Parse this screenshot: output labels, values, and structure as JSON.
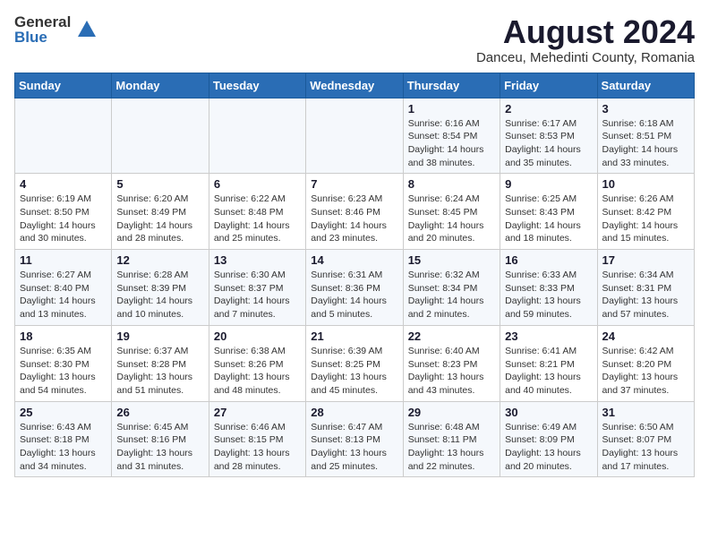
{
  "header": {
    "logo_line1": "General",
    "logo_line2": "Blue",
    "month_title": "August 2024",
    "location": "Danceu, Mehedinti County, Romania"
  },
  "weekdays": [
    "Sunday",
    "Monday",
    "Tuesday",
    "Wednesday",
    "Thursday",
    "Friday",
    "Saturday"
  ],
  "weeks": [
    [
      {
        "day": "",
        "info": ""
      },
      {
        "day": "",
        "info": ""
      },
      {
        "day": "",
        "info": ""
      },
      {
        "day": "",
        "info": ""
      },
      {
        "day": "1",
        "info": "Sunrise: 6:16 AM\nSunset: 8:54 PM\nDaylight: 14 hours\nand 38 minutes."
      },
      {
        "day": "2",
        "info": "Sunrise: 6:17 AM\nSunset: 8:53 PM\nDaylight: 14 hours\nand 35 minutes."
      },
      {
        "day": "3",
        "info": "Sunrise: 6:18 AM\nSunset: 8:51 PM\nDaylight: 14 hours\nand 33 minutes."
      }
    ],
    [
      {
        "day": "4",
        "info": "Sunrise: 6:19 AM\nSunset: 8:50 PM\nDaylight: 14 hours\nand 30 minutes."
      },
      {
        "day": "5",
        "info": "Sunrise: 6:20 AM\nSunset: 8:49 PM\nDaylight: 14 hours\nand 28 minutes."
      },
      {
        "day": "6",
        "info": "Sunrise: 6:22 AM\nSunset: 8:48 PM\nDaylight: 14 hours\nand 25 minutes."
      },
      {
        "day": "7",
        "info": "Sunrise: 6:23 AM\nSunset: 8:46 PM\nDaylight: 14 hours\nand 23 minutes."
      },
      {
        "day": "8",
        "info": "Sunrise: 6:24 AM\nSunset: 8:45 PM\nDaylight: 14 hours\nand 20 minutes."
      },
      {
        "day": "9",
        "info": "Sunrise: 6:25 AM\nSunset: 8:43 PM\nDaylight: 14 hours\nand 18 minutes."
      },
      {
        "day": "10",
        "info": "Sunrise: 6:26 AM\nSunset: 8:42 PM\nDaylight: 14 hours\nand 15 minutes."
      }
    ],
    [
      {
        "day": "11",
        "info": "Sunrise: 6:27 AM\nSunset: 8:40 PM\nDaylight: 14 hours\nand 13 minutes."
      },
      {
        "day": "12",
        "info": "Sunrise: 6:28 AM\nSunset: 8:39 PM\nDaylight: 14 hours\nand 10 minutes."
      },
      {
        "day": "13",
        "info": "Sunrise: 6:30 AM\nSunset: 8:37 PM\nDaylight: 14 hours\nand 7 minutes."
      },
      {
        "day": "14",
        "info": "Sunrise: 6:31 AM\nSunset: 8:36 PM\nDaylight: 14 hours\nand 5 minutes."
      },
      {
        "day": "15",
        "info": "Sunrise: 6:32 AM\nSunset: 8:34 PM\nDaylight: 14 hours\nand 2 minutes."
      },
      {
        "day": "16",
        "info": "Sunrise: 6:33 AM\nSunset: 8:33 PM\nDaylight: 13 hours\nand 59 minutes."
      },
      {
        "day": "17",
        "info": "Sunrise: 6:34 AM\nSunset: 8:31 PM\nDaylight: 13 hours\nand 57 minutes."
      }
    ],
    [
      {
        "day": "18",
        "info": "Sunrise: 6:35 AM\nSunset: 8:30 PM\nDaylight: 13 hours\nand 54 minutes."
      },
      {
        "day": "19",
        "info": "Sunrise: 6:37 AM\nSunset: 8:28 PM\nDaylight: 13 hours\nand 51 minutes."
      },
      {
        "day": "20",
        "info": "Sunrise: 6:38 AM\nSunset: 8:26 PM\nDaylight: 13 hours\nand 48 minutes."
      },
      {
        "day": "21",
        "info": "Sunrise: 6:39 AM\nSunset: 8:25 PM\nDaylight: 13 hours\nand 45 minutes."
      },
      {
        "day": "22",
        "info": "Sunrise: 6:40 AM\nSunset: 8:23 PM\nDaylight: 13 hours\nand 43 minutes."
      },
      {
        "day": "23",
        "info": "Sunrise: 6:41 AM\nSunset: 8:21 PM\nDaylight: 13 hours\nand 40 minutes."
      },
      {
        "day": "24",
        "info": "Sunrise: 6:42 AM\nSunset: 8:20 PM\nDaylight: 13 hours\nand 37 minutes."
      }
    ],
    [
      {
        "day": "25",
        "info": "Sunrise: 6:43 AM\nSunset: 8:18 PM\nDaylight: 13 hours\nand 34 minutes."
      },
      {
        "day": "26",
        "info": "Sunrise: 6:45 AM\nSunset: 8:16 PM\nDaylight: 13 hours\nand 31 minutes."
      },
      {
        "day": "27",
        "info": "Sunrise: 6:46 AM\nSunset: 8:15 PM\nDaylight: 13 hours\nand 28 minutes."
      },
      {
        "day": "28",
        "info": "Sunrise: 6:47 AM\nSunset: 8:13 PM\nDaylight: 13 hours\nand 25 minutes."
      },
      {
        "day": "29",
        "info": "Sunrise: 6:48 AM\nSunset: 8:11 PM\nDaylight: 13 hours\nand 22 minutes."
      },
      {
        "day": "30",
        "info": "Sunrise: 6:49 AM\nSunset: 8:09 PM\nDaylight: 13 hours\nand 20 minutes."
      },
      {
        "day": "31",
        "info": "Sunrise: 6:50 AM\nSunset: 8:07 PM\nDaylight: 13 hours\nand 17 minutes."
      }
    ]
  ]
}
